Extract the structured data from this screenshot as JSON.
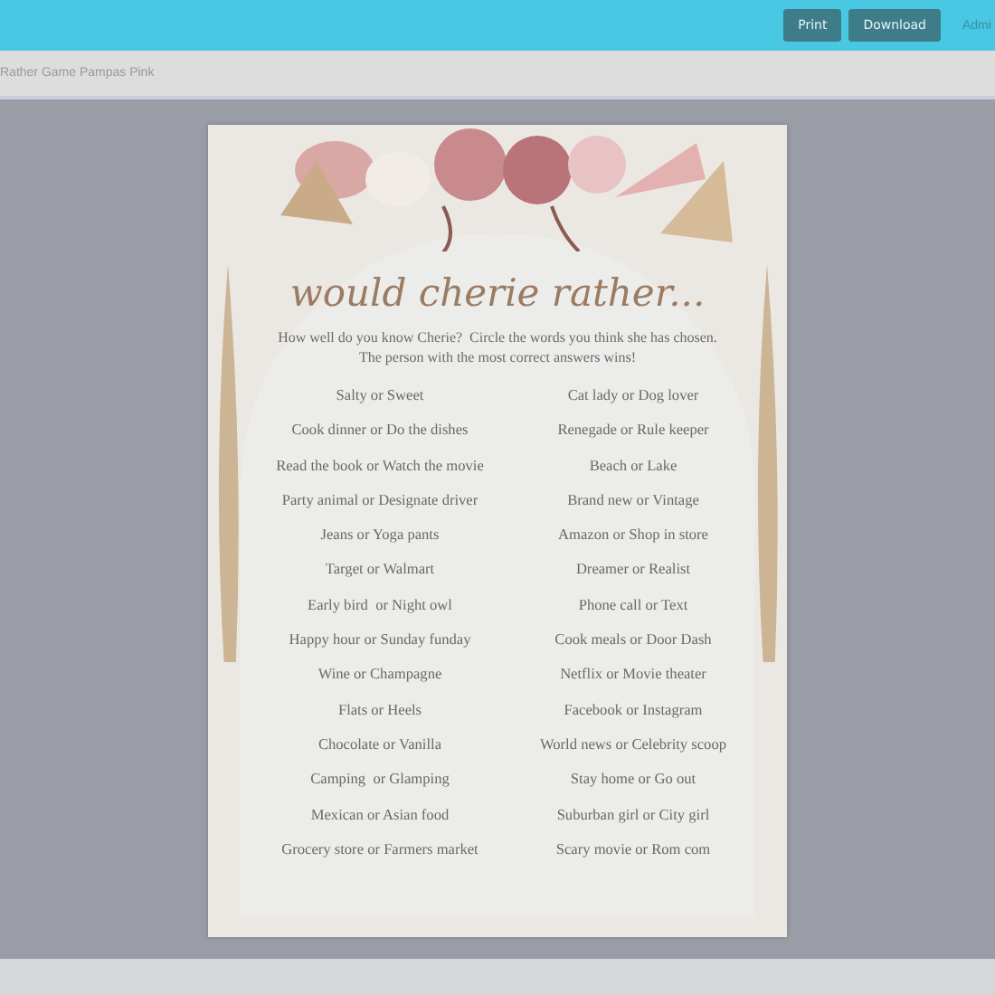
{
  "top_bar": {
    "buttons": [
      "Print",
      "Download"
    ],
    "admin_link": "Admi"
  },
  "breadcrumb": "Rather Game Pampas Pink",
  "document": {
    "title": "would cherie rather...",
    "intro": "How well do you know Cherie?  Circle the words you think she has chosen. The person with the most correct answers wins!",
    "choices": [
      {
        "left": "Salty or Sweet",
        "right": "Cat lady or Dog lover"
      },
      {
        "left": "Cook dinner or Do the dishes",
        "right": "Renegade or Rule keeper"
      },
      {
        "left": "Read the book or Watch the movie",
        "right": "Beach or Lake"
      },
      {
        "left": "Party animal or Designate driver",
        "right": "Brand new or Vintage"
      },
      {
        "left": "Jeans or Yoga pants",
        "right": "Amazon or Shop in store"
      },
      {
        "left": "Target or Walmart",
        "right": "Dreamer or Realist"
      },
      {
        "left": "Early bird  or Night owl",
        "right": "Phone call or Text"
      },
      {
        "left": "Happy hour or Sunday funday",
        "right": "Cook meals or Door Dash"
      },
      {
        "left": "Wine or Champagne",
        "right": "Netflix or Movie theater"
      },
      {
        "left": "Flats or Heels",
        "right": "Facebook or Instagram"
      },
      {
        "left": "Chocolate or Vanilla",
        "right": "World news or Celebrity scoop"
      },
      {
        "left": "Camping  or Glamping",
        "right": "Stay home or Go out"
      },
      {
        "left": "Mexican or Asian food",
        "right": "Suburban girl or City girl"
      },
      {
        "left": "Grocery store or Farmers market",
        "right": "Scary movie or Rom com"
      }
    ]
  }
}
